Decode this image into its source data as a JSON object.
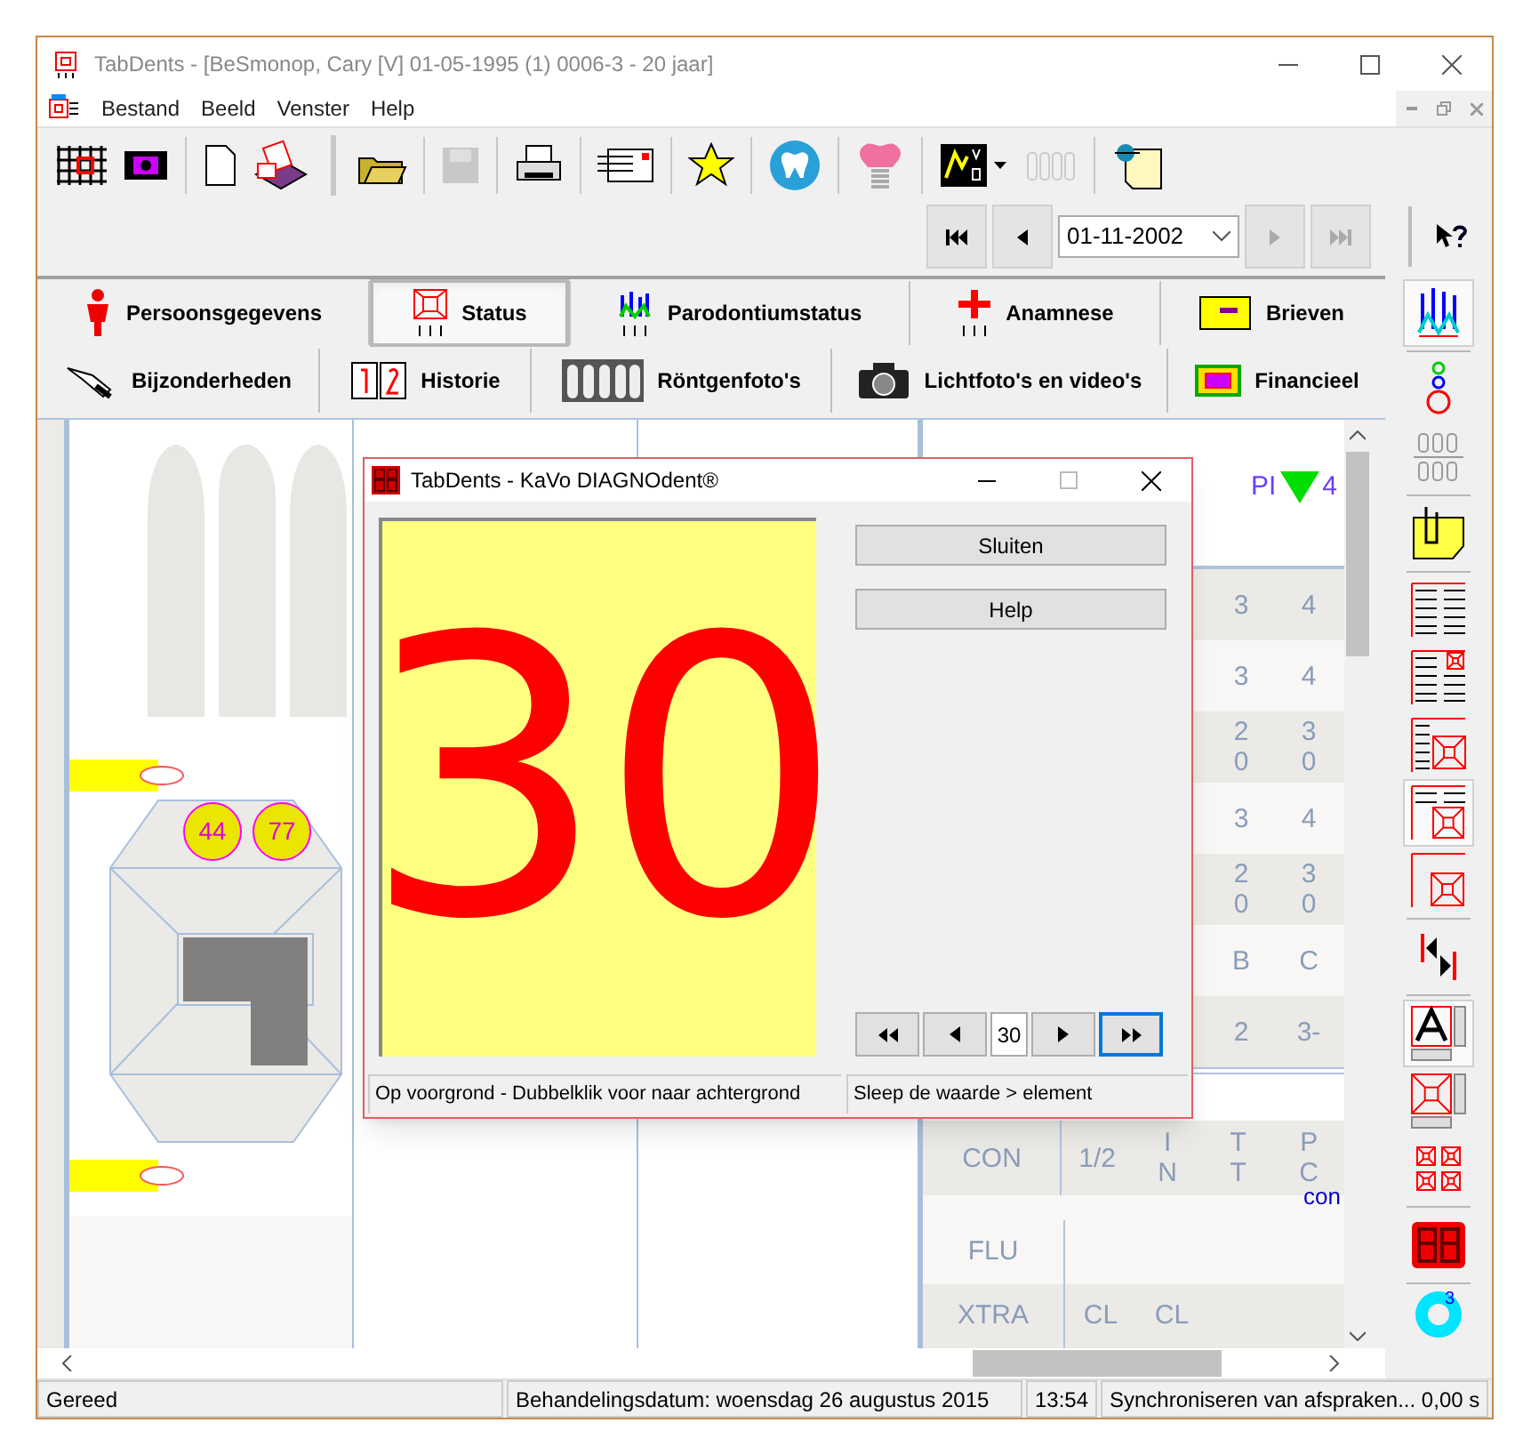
{
  "window": {
    "title": "TabDents - [BeSmonop, Cary [V] 01-05-1995 (1) 0006-3 - 20 jaar]"
  },
  "menu": [
    {
      "label": "Bestand"
    },
    {
      "label": "Beeld"
    },
    {
      "label": "Venster"
    },
    {
      "label": "Help"
    }
  ],
  "toolbar": [
    {
      "disabled": false
    },
    {
      "disabled": false
    },
    {
      "disabled": false
    },
    {
      "disabled": false
    },
    {
      "disabled": false
    },
    {
      "disabled": true
    },
    {
      "disabled": false
    },
    {
      "disabled": false
    },
    {
      "disabled": false
    },
    {
      "disabled": false
    },
    {
      "disabled": false
    },
    {
      "disabled": false
    },
    {
      "disabled": true
    },
    {
      "disabled": false
    }
  ],
  "navigator": {
    "date": "01-11-2002",
    "buttons": [
      {
        "kind": "first",
        "disabled": false
      },
      {
        "kind": "prev",
        "disabled": false
      },
      {
        "kind": "next",
        "disabled": true
      },
      {
        "kind": "last",
        "disabled": true
      }
    ]
  },
  "tabs": [
    [
      {
        "label": "Persoonsgegevens",
        "selected": false
      },
      {
        "label": "Status",
        "selected": true
      },
      {
        "label": "Parodontiumstatus",
        "selected": false
      },
      {
        "label": "Anamnese",
        "selected": false
      },
      {
        "label": "Brieven",
        "selected": false
      }
    ],
    [
      {
        "label": "Bijzonderheden",
        "selected": false
      },
      {
        "label": "Historie",
        "selected": false
      },
      {
        "label": "Röntgenfoto's",
        "selected": false
      },
      {
        "label": "Lichtfoto's en video's",
        "selected": false
      },
      {
        "label": "Financieel",
        "selected": false
      }
    ]
  ],
  "chart": {
    "badges": [
      "44",
      "77"
    ],
    "pi_label": "PI",
    "pi_value": "4",
    "rows": [
      [
        "3",
        "4"
      ],
      [
        "3",
        "4"
      ],
      [
        "2 0",
        "3 0"
      ],
      [
        "3",
        "4"
      ],
      [
        "2 0",
        "3 0"
      ],
      [
        "B",
        "C"
      ],
      [
        "2",
        "3-"
      ]
    ],
    "lower_header": [
      "CON",
      "1/2",
      "I N",
      "T T",
      "P C"
    ],
    "lower_note": "con",
    "lower_rows": [
      [
        "FLU"
      ],
      [
        "XTRA",
        "CL",
        "CL"
      ]
    ]
  },
  "dialog": {
    "title": "TabDents - KaVo DIAGNOdent®",
    "reading": "30",
    "buttons": [
      "Sluiten",
      "Help"
    ],
    "stepper": {
      "value": "30",
      "buttons": [
        {
          "kind": "first",
          "focused": false
        },
        {
          "kind": "prev",
          "focused": false
        },
        {
          "kind": "next",
          "focused": false
        },
        {
          "kind": "last",
          "focused": true
        }
      ]
    },
    "status": [
      "Op voorgrond - Dubbelklik voor naar achtergrond",
      "Sleep de waarde > element"
    ]
  },
  "right_toolbar": [
    {
      "selected": true
    },
    {
      "selected": false
    },
    {
      "selected": false
    },
    {
      "selected": false
    },
    {
      "selected": false
    },
    {
      "selected": false
    },
    {
      "selected": false
    },
    {
      "selected": true
    },
    {
      "selected": false
    },
    {
      "selected": false
    },
    {
      "selected": true
    },
    {
      "selected": false
    },
    {
      "selected": false
    },
    {
      "selected": false
    }
  ],
  "right_toolbar_badge": "3",
  "status_bar": [
    "Gereed",
    "Behandelingsdatum: woensdag 26 augustus 2015",
    "13:54",
    "Synchroniseren van afspraken... 0,00 s"
  ]
}
